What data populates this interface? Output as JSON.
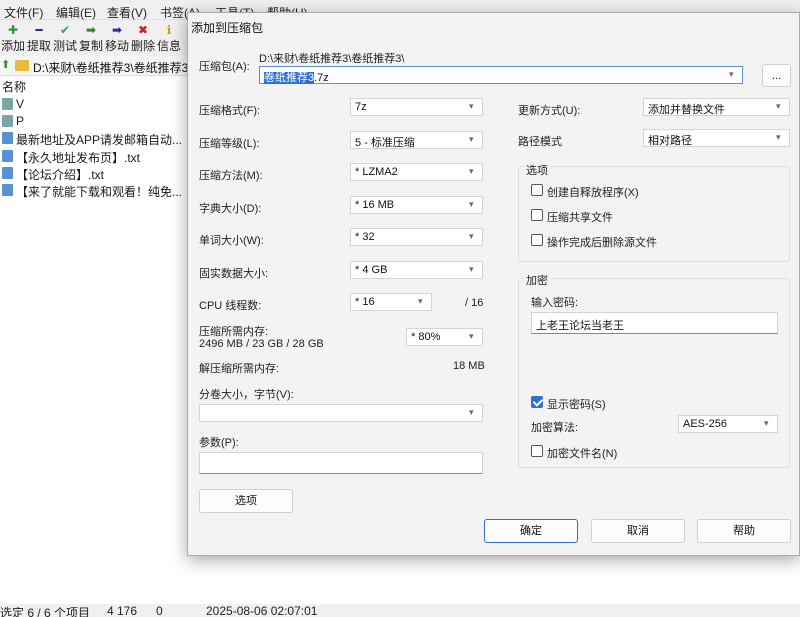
{
  "menu": [
    "文件(F)",
    "编辑(E)",
    "查看(V)",
    "书签(A)",
    "工具(T)",
    "帮助(H)"
  ],
  "toolbar": [
    {
      "label": "添加",
      "icon": "plus-icon",
      "glyph": "✚",
      "color": "#2a9a2a"
    },
    {
      "label": "提取",
      "icon": "minus-icon",
      "glyph": "━",
      "color": "#2a2aa0"
    },
    {
      "label": "测试",
      "icon": "check-icon",
      "glyph": "✔",
      "color": "#2a9aa0"
    },
    {
      "label": "复制",
      "icon": "copy-arrow-icon",
      "glyph": "➡",
      "color": "#2a8a2a"
    },
    {
      "label": "移动",
      "icon": "move-arrow-icon",
      "glyph": "➡",
      "color": "#2a2aa0"
    },
    {
      "label": "删除",
      "icon": "delete-icon",
      "glyph": "✖",
      "color": "#cc2020"
    },
    {
      "label": "信息",
      "icon": "info-icon",
      "glyph": "ℹ",
      "color": "#c8a000"
    }
  ],
  "address": {
    "path": "D:\\来财\\卷纸推荐3\\卷纸推荐3"
  },
  "filelist": {
    "column": "名称",
    "items": [
      {
        "name": "V",
        "type": "folder"
      },
      {
        "name": "P",
        "type": "folder"
      },
      {
        "name": "最新地址及APP请发邮箱自动...",
        "type": "doc"
      },
      {
        "name": "【永久地址发布页】.txt",
        "type": "doc"
      },
      {
        "name": "【论坛介绍】.txt",
        "type": "doc"
      },
      {
        "name": "【来了就能下载和观看！纯免...",
        "type": "doc"
      }
    ]
  },
  "status": {
    "selected": "选定 6 / 6 个项目",
    "size": "4 176",
    "packed": "0",
    "date": "2025-08-06 02:07:01"
  },
  "dialog": {
    "title": "添加到压缩包",
    "archive_label": "压缩包(A):",
    "archive_dir": "D:\\来财\\卷纸推荐3\\卷纸推荐3\\",
    "archive_name_selected": "卷纸推荐3",
    "archive_name_ext": ".7z",
    "browse_label": "...",
    "format_label": "压缩格式(F):",
    "format_value": "7z",
    "level_label": "压缩等级(L):",
    "level_value": "5 - 标准压缩",
    "method_label": "压缩方法(M):",
    "method_value": "*  LZMA2",
    "dict_label": "字典大小(D):",
    "dict_value": "*  16 MB",
    "word_label": "单词大小(W):",
    "word_value": "*  32",
    "solid_label": "固实数据大小:",
    "solid_value": "*  4 GB",
    "threads_label": "CPU 线程数:",
    "threads_value": "*  16",
    "threads_total": "/ 16",
    "mem_comp_label": "压缩所需内存:",
    "mem_comp_value": "2496 MB / 23 GB / 28 GB",
    "mem_percent": "* 80%",
    "mem_decomp_label": "解压缩所需内存:",
    "mem_decomp_value": "18 MB",
    "split_label": "分卷大小，字节(V):",
    "split_value": "",
    "params_label": "参数(P):",
    "params_value": "",
    "options_button": "选项",
    "update_label": "更新方式(U):",
    "update_value": "添加并替换文件",
    "path_label": "路径模式",
    "path_value": "相对路径",
    "options_group": "选项",
    "opt_sfx": "创建自释放程序(X)",
    "opt_shared": "压缩共享文件",
    "opt_delete": "操作完成后删除源文件",
    "encrypt_group": "加密",
    "password_label": "输入密码:",
    "password_value": "上老王论坛当老王",
    "show_password": "显示密码(S)",
    "enc_method_label": "加密算法:",
    "enc_method_value": "AES-256",
    "encrypt_names": "加密文件名(N)",
    "ok": "确定",
    "cancel": "取消",
    "help": "帮助"
  }
}
